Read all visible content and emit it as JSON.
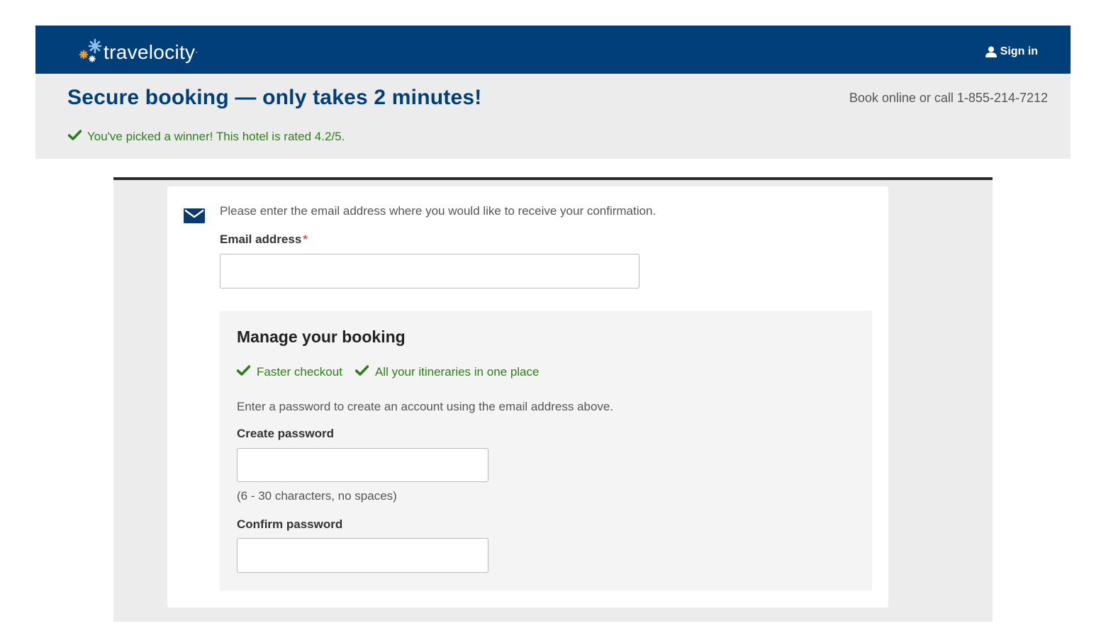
{
  "header": {
    "logo_text": "travelocity",
    "logo_mark": "·",
    "signin_label": "Sign in",
    "signin_icon": "user-icon",
    "background_color": "#003f7a"
  },
  "banner": {
    "title": "Secure booking — only takes 2 minutes!",
    "phone_text": "Book online or call 1-855-214-7212",
    "rating_text": "You've picked a winner! This hotel is rated 4.2/5.",
    "rating_icon": "checkmark-icon"
  },
  "email_section": {
    "icon": "envelope-icon",
    "intro": "Please enter the email address where you would like to receive your confirmation.",
    "email_label": "Email address",
    "required_marker": "*",
    "email_value": ""
  },
  "manage_booking": {
    "title": "Manage your booking",
    "benefits": [
      {
        "label": "Faster checkout",
        "icon": "checkmark-icon"
      },
      {
        "label": "All your itineraries in one place",
        "icon": "checkmark-icon"
      }
    ],
    "description": "Enter a password to create an account using the email address above.",
    "create_password_label": "Create password",
    "create_password_value": "",
    "password_hint": "(6 - 30 characters, no spaces)",
    "confirm_password_label": "Confirm password",
    "confirm_password_value": ""
  },
  "colors": {
    "brand_blue": "#003f7a",
    "success_green": "#2e7d1b",
    "required_red": "#d9534f",
    "logo_orange": "#f39a2b",
    "logo_lightblue": "#8fc4ea"
  }
}
